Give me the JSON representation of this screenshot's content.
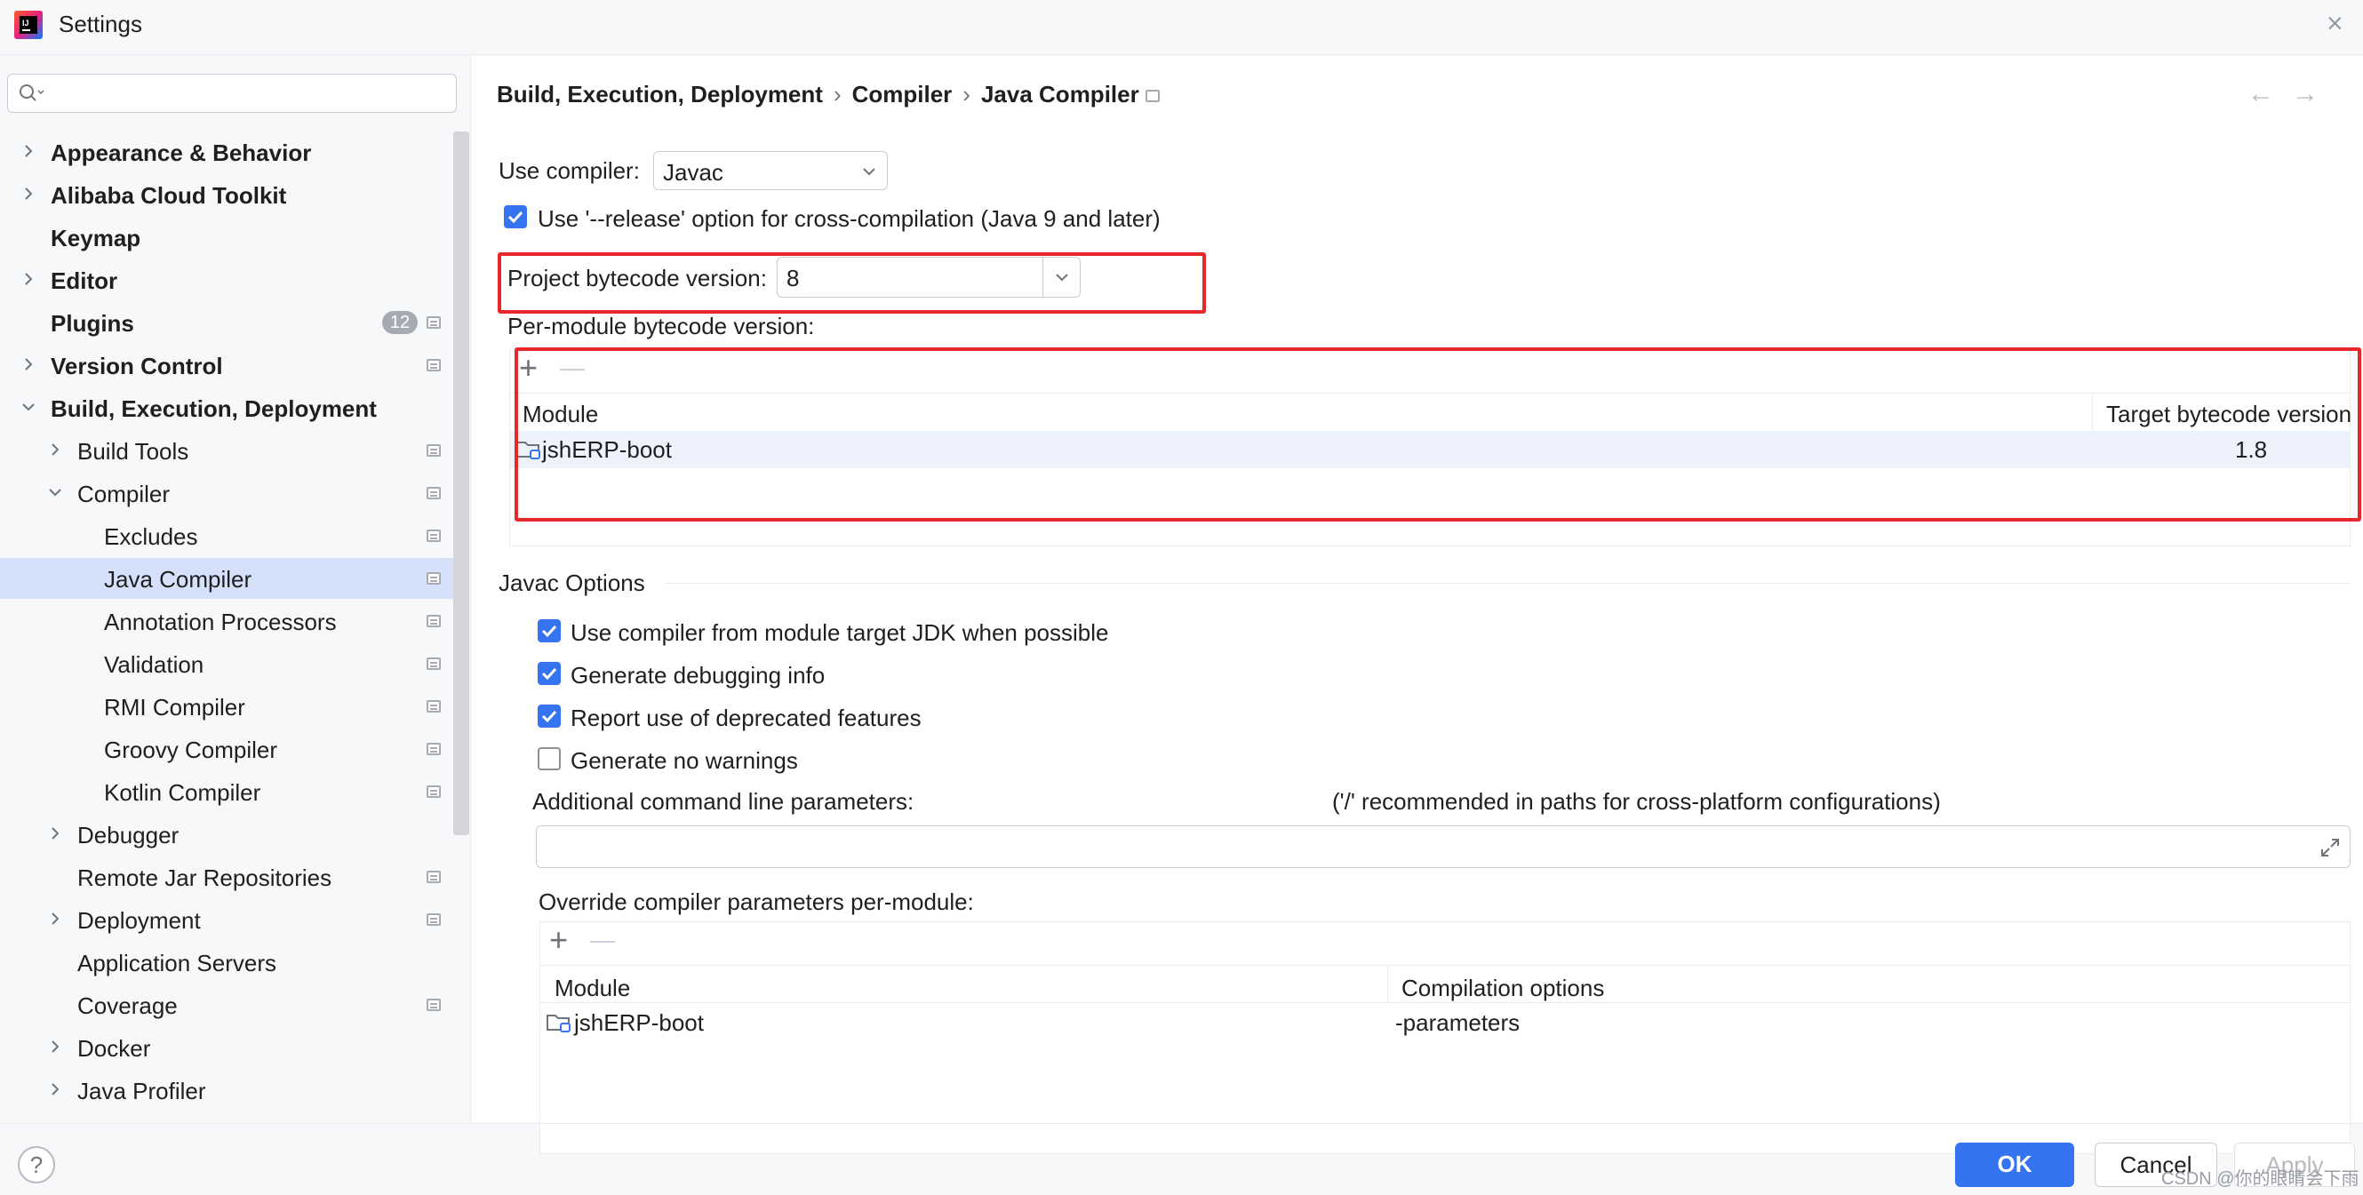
{
  "window": {
    "title": "Settings"
  },
  "search": {
    "placeholder": ""
  },
  "sidebar": {
    "items": [
      {
        "label": "Appearance & Behavior"
      },
      {
        "label": "Alibaba Cloud Toolkit"
      },
      {
        "label": "Keymap"
      },
      {
        "label": "Editor"
      },
      {
        "label": "Plugins",
        "badge": "12"
      },
      {
        "label": "Version Control"
      },
      {
        "label": "Build, Execution, Deployment"
      },
      {
        "label": "Build Tools"
      },
      {
        "label": "Compiler"
      },
      {
        "label": "Excludes"
      },
      {
        "label": "Java Compiler"
      },
      {
        "label": "Annotation Processors"
      },
      {
        "label": "Validation"
      },
      {
        "label": "RMI Compiler"
      },
      {
        "label": "Groovy Compiler"
      },
      {
        "label": "Kotlin Compiler"
      },
      {
        "label": "Debugger"
      },
      {
        "label": "Remote Jar Repositories"
      },
      {
        "label": "Deployment"
      },
      {
        "label": "Application Servers"
      },
      {
        "label": "Coverage"
      },
      {
        "label": "Docker"
      },
      {
        "label": "Java Profiler"
      }
    ]
  },
  "breadcrumb": {
    "part1": "Build, Execution, Deployment",
    "part2": "Compiler",
    "part3": "Java Compiler",
    "sep": "›"
  },
  "nav": {
    "back": "←",
    "forward": "→"
  },
  "compiler": {
    "use_compiler_label": "Use compiler:",
    "use_compiler_value": "Javac",
    "release_option_label": "Use '--release' option for cross-compilation (Java 9 and later)",
    "release_option_checked": true,
    "bytecode_label": "Project bytecode version:",
    "bytecode_value": "8",
    "per_module_label": "Per-module bytecode version:",
    "per_module_table": {
      "add": "+",
      "remove": "—",
      "col_module": "Module",
      "col_target": "Target bytecode version",
      "rows": [
        {
          "module": "jshERP-boot",
          "target": "1.8"
        }
      ]
    }
  },
  "javac": {
    "section_title": "Javac Options",
    "options": [
      {
        "label": "Use compiler from module target JDK when possible",
        "checked": true
      },
      {
        "label": "Generate debugging info",
        "checked": true
      },
      {
        "label": "Report use of deprecated features",
        "checked": true
      },
      {
        "label": "Generate no warnings",
        "checked": false
      }
    ],
    "additional_label": "Additional command line parameters:",
    "additional_hint": "('/' recommended in paths for cross-platform configurations)",
    "additional_value": "",
    "override_label": "Override compiler parameters per-module:",
    "override_table": {
      "add": "+",
      "remove": "—",
      "col_module": "Module",
      "col_options": "Compilation options",
      "rows": [
        {
          "module": "jshERP-boot",
          "options": "-parameters"
        }
      ]
    }
  },
  "footer": {
    "help": "?",
    "ok": "OK",
    "cancel": "Cancel",
    "apply": "Apply",
    "watermark": "CSDN @你的眼睛会下雨"
  },
  "colors": {
    "accent": "#3574f0",
    "highlight": "#e8272a",
    "selection": "#d5e1fb"
  }
}
